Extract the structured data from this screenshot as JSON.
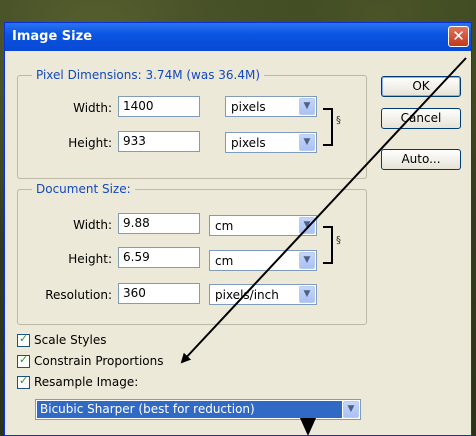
{
  "window": {
    "title": "Image Size"
  },
  "pixel_dimensions": {
    "legend": "Pixel Dimensions:",
    "size": "3.74M (was 36.4M)",
    "width": {
      "label": "Width:",
      "value": "1400",
      "unit": "pixels"
    },
    "height": {
      "label": "Height:",
      "value": "933",
      "unit": "pixels"
    }
  },
  "document_size": {
    "legend": "Document Size:",
    "width": {
      "label": "Width:",
      "value": "9.88",
      "unit": "cm"
    },
    "height": {
      "label": "Height:",
      "value": "6.59",
      "unit": "cm"
    },
    "resolution": {
      "label": "Resolution:",
      "value": "360",
      "unit": "pixels/inch"
    }
  },
  "buttons": {
    "ok": "OK",
    "cancel": "Cancel",
    "auto": "Auto..."
  },
  "options": {
    "scale_styles": {
      "label": "Scale Styles",
      "checked": true
    },
    "constrain_proportions": {
      "label": "Constrain Proportions",
      "checked": true
    },
    "resample_image": {
      "label": "Resample Image:",
      "checked": true
    }
  },
  "resample_method": {
    "value": "Bicubic Sharper (best for reduction)"
  },
  "icons": {
    "close": "close-icon",
    "link": "chain-link-icon",
    "dropdown": "chevron-down-icon",
    "check": "checkmark-icon"
  }
}
